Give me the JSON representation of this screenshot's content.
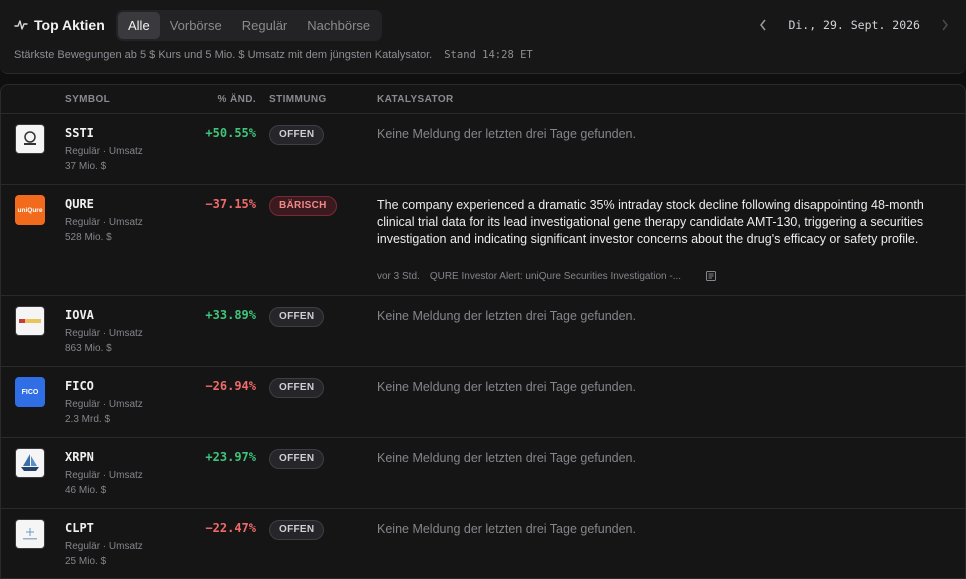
{
  "header": {
    "title": "Top Aktien",
    "tabs": [
      {
        "label": "Alle",
        "active": true
      },
      {
        "label": "Vorbörse",
        "active": false
      },
      {
        "label": "Regulär",
        "active": false
      },
      {
        "label": "Nachbörse",
        "active": false
      }
    ],
    "subtitle": "Stärkste Bewegungen ab 5 $ Kurs und 5 Mio. $ Umsatz mit dem jüngsten Katalysator.",
    "stand": "Stand 14:28 ET",
    "date": "Di., 29. Sept. 2026"
  },
  "table": {
    "columns": {
      "symbol": "SYMBOL",
      "change": "% ÄND.",
      "sentiment": "STIMMUNG",
      "catalyst": "KATALYSATOR"
    },
    "rows": [
      {
        "symbol": "SSTI",
        "session": "Regulär · Umsatz",
        "volume": "37 Mio. $",
        "change": "+50.55%",
        "direction": "up",
        "sentiment": "OFFEN",
        "catalyst": "Keine Meldung der letzten drei Tage gefunden.",
        "logo_color": "#f5f5f5"
      },
      {
        "symbol": "QURE",
        "session": "Regulär · Umsatz",
        "volume": "528 Mio. $",
        "change": "−37.15%",
        "direction": "down",
        "sentiment": "BÄRISCH",
        "catalyst": "The company experienced a dramatic 35% intraday stock decline following disappointing 48-month clinical trial data for its lead investigational gene therapy candidate AMT-130, triggering a securities investigation and indicating significant investor concerns about the drug's efficacy or safety profile.",
        "source_time": "vor 3 Std.",
        "source_title": "QURE Investor Alert: uniQure Securities Investigation -...",
        "logo_text": "uniQure",
        "logo_color": "#f26b1d"
      },
      {
        "symbol": "IOVA",
        "session": "Regulär · Umsatz",
        "volume": "863 Mio. $",
        "change": "+33.89%",
        "direction": "up",
        "sentiment": "OFFEN",
        "catalyst": "Keine Meldung der letzten drei Tage gefunden.",
        "logo_color": "#f5f5f5"
      },
      {
        "symbol": "FICO",
        "session": "Regulär · Umsatz",
        "volume": "2.3 Mrd. $",
        "change": "−26.94%",
        "direction": "down",
        "sentiment": "OFFEN",
        "catalyst": "Keine Meldung der letzten drei Tage gefunden.",
        "logo_text": "FICO",
        "logo_color": "#2f6ee5"
      },
      {
        "symbol": "XRPN",
        "session": "Regulär · Umsatz",
        "volume": "46 Mio. $",
        "change": "+23.97%",
        "direction": "up",
        "sentiment": "OFFEN",
        "catalyst": "Keine Meldung der letzten drei Tage gefunden.",
        "logo_color": "#f5f5f5"
      },
      {
        "symbol": "CLPT",
        "session": "Regulär · Umsatz",
        "volume": "25 Mio. $",
        "change": "−22.47%",
        "direction": "down",
        "sentiment": "OFFEN",
        "catalyst": "Keine Meldung der letzten drei Tage gefunden.",
        "logo_color": "#f5f5f5"
      }
    ]
  }
}
